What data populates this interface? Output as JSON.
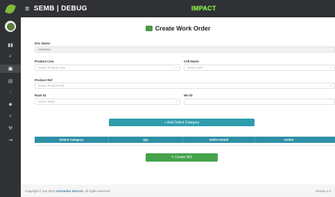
{
  "header": {
    "burger_icon": "menu-icon",
    "app_title": "SEMB | DEBUG",
    "brand": "IMPACT"
  },
  "sidebar": {
    "icons": [
      "dashboard-icon",
      "search-icon",
      "work-order-icon",
      "list-icon",
      "settings-icon",
      "gear-icon",
      "search-alt-icon",
      "wrench-icon",
      "logout-icon"
    ],
    "active_index": 2
  },
  "page": {
    "title": "Create Work Order",
    "title_icon": "work-order-icon"
  },
  "form": {
    "doc_name_label": "Doc Name",
    "doc_name_value": "SEMWM",
    "product_line_label": "Product Line",
    "product_line_value": "Select Product Line",
    "cell_name_label": "Cell Name",
    "cell_name_value": "Select Cell",
    "product_ref_label": "Product Ref",
    "product_ref_value": "Select Product Ref",
    "rack_id_label": "Rack ID",
    "rack_id_value": "Select Rack",
    "wo_id_label": "Wo ID",
    "wo_id_value": ""
  },
  "actions": {
    "add_defect": "+ Add Defect Category",
    "create_wo": "✎ Create WO"
  },
  "table": {
    "columns": [
      "Defect Category",
      "Qty",
      "Defect Detail",
      "Action"
    ]
  },
  "footer": {
    "copyright_prefix": "Copyright © Jun 2023",
    "company": "Schneider Electric",
    "rights": ". All rights reserved.",
    "version": "Version 1.0"
  },
  "colors": {
    "topbar": "#2f3134",
    "accent": "#2e9dad",
    "success": "#45a24b",
    "brand": "#7fdc43"
  }
}
